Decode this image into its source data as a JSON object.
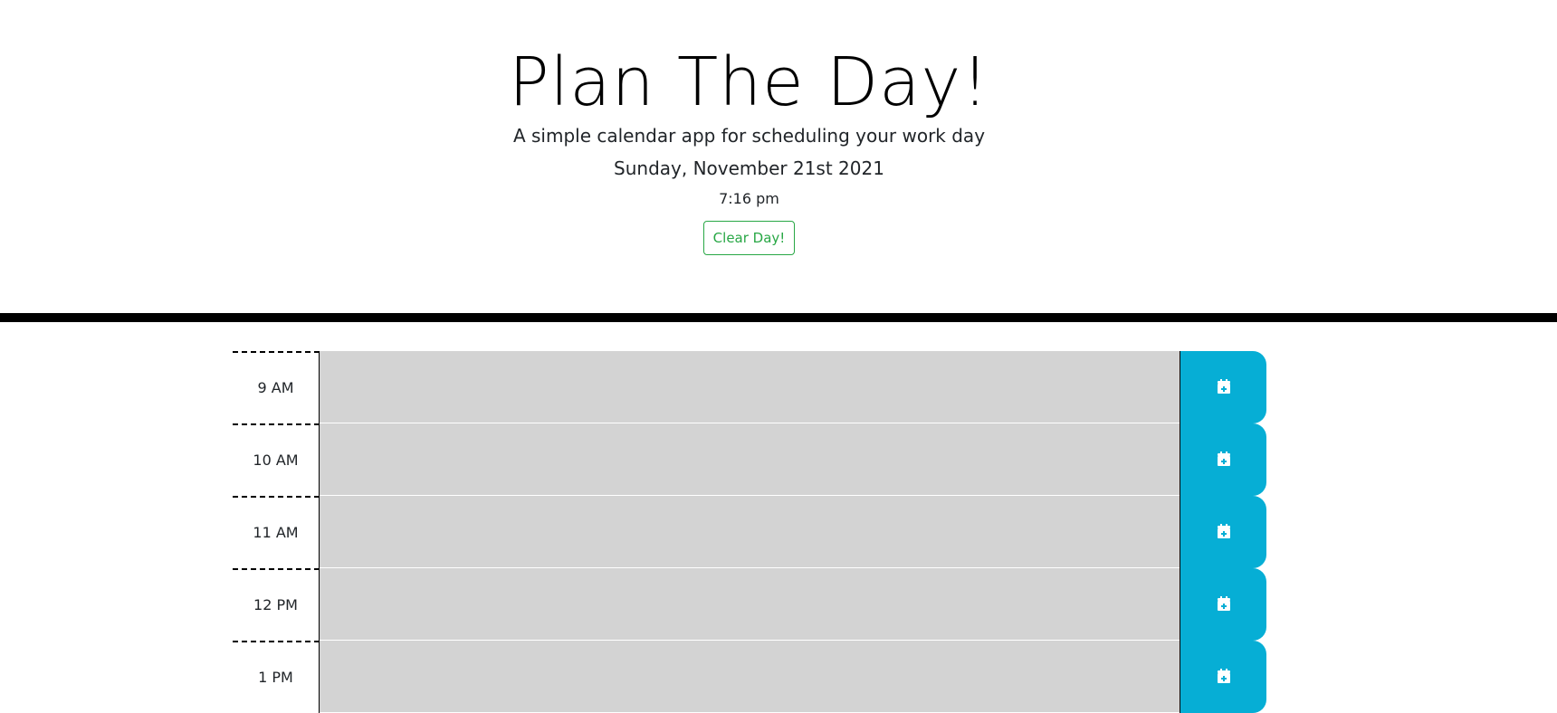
{
  "header": {
    "title": "Plan The Day!",
    "subtitle": "A simple calendar app for scheduling your work day",
    "date": "Sunday, November 21st 2021",
    "time": "7:16 pm",
    "clear_label": "Clear Day!"
  },
  "colors": {
    "clear_button": "#28a745",
    "save_button": "#06aed5",
    "past_slot": "#d3d3d3"
  },
  "timeslots": [
    {
      "hour": "9 AM",
      "event": "",
      "save_icon": "calendar-plus-icon"
    },
    {
      "hour": "10 AM",
      "event": "",
      "save_icon": "calendar-plus-icon"
    },
    {
      "hour": "11 AM",
      "event": "",
      "save_icon": "calendar-plus-icon"
    },
    {
      "hour": "12 PM",
      "event": "",
      "save_icon": "calendar-plus-icon"
    },
    {
      "hour": "1 PM",
      "event": "",
      "save_icon": "calendar-plus-icon"
    }
  ]
}
